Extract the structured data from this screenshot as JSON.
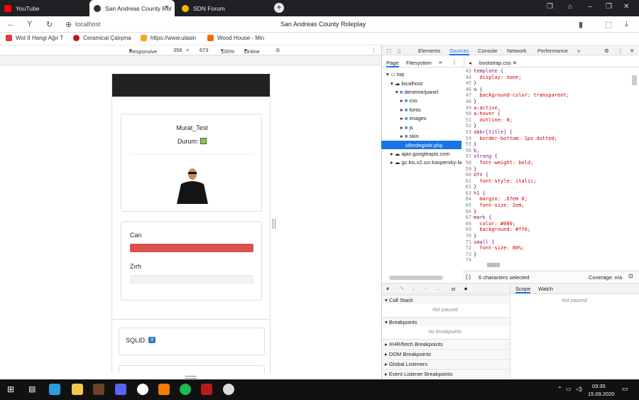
{
  "tabs": [
    {
      "label": "YouTube",
      "favcolor": "#ff0000"
    },
    {
      "label": "San Andreas County Rol",
      "favcolor": "#e8e8e8"
    },
    {
      "label": "SDN Forum",
      "favcolor": "#f5b700"
    }
  ],
  "window_title": "San Andreas County Roleplay",
  "url": "localhost",
  "bookmarks": [
    "Wot II Hangi Ağır T",
    "Ceramical Çalışma",
    "https://www.ulasin",
    "Wood House - Min"
  ],
  "device": {
    "mode": "Responsive",
    "width": "358",
    "height": "673",
    "zoom": "100%",
    "network": "Online"
  },
  "page": {
    "username": "Murat_Test",
    "durum_label": "Durum:",
    "can_label": "Can",
    "can_value": 1.0,
    "zirh_label": "Zırh",
    "zirh_value": 0,
    "sqlid_label": "SQLID:",
    "sqlid_value": "3"
  },
  "devtools": {
    "tabs": [
      "Elements",
      "Sources",
      "Console",
      "Network",
      "Performance"
    ],
    "sub_tabs": [
      "Page",
      "Filesystem"
    ],
    "file_tab": "bootstrap.css",
    "status": "6 characters selected",
    "coverage": "Coverage: n/a",
    "tree": [
      "top",
      "localhost",
      "deneme/panel",
      "css",
      "fonts",
      "images",
      "js",
      "skin",
      "sifredegistir.php",
      "ajax.googleapis.com",
      "gc.kis.v2.scr.kaspersky-la"
    ],
    "sections": [
      "Call Stack",
      "Breakpoints",
      "XHR/fetch Breakpoints",
      "DOM Breakpoints",
      "Global Listeners",
      "Event Listener Breakpoints"
    ],
    "not_paused": "Not paused",
    "no_breakpoints": "No breakpoints",
    "scope": "Scope",
    "watch": "Watch"
  },
  "code": [
    [
      "43",
      "template {"
    ],
    [
      "44",
      "  display: none;"
    ],
    [
      "45",
      "}"
    ],
    [
      "46",
      "a {"
    ],
    [
      "47",
      "  background-color: transparent;"
    ],
    [
      "48",
      "}"
    ],
    [
      "49",
      "a:active,"
    ],
    [
      "50",
      "a:hover {"
    ],
    [
      "51",
      "  outline: 0;"
    ],
    [
      "52",
      "}"
    ],
    [
      "53",
      "abbr[title] {"
    ],
    [
      "54",
      "  border-bottom: 1px dotted;"
    ],
    [
      "55",
      "}"
    ],
    [
      "56",
      "b,"
    ],
    [
      "57",
      "strong {"
    ],
    [
      "58",
      "  font-weight: bold;"
    ],
    [
      "59",
      "}"
    ],
    [
      "60",
      "dfn {"
    ],
    [
      "61",
      "  font-style: italic;"
    ],
    [
      "62",
      "}"
    ],
    [
      "63",
      "h1 {"
    ],
    [
      "64",
      "  margin: .67em 0;"
    ],
    [
      "65",
      "  font-size: 2em;"
    ],
    [
      "66",
      "}"
    ],
    [
      "67",
      "mark {"
    ],
    [
      "68",
      "  color: #000;"
    ],
    [
      "69",
      "  background: #ff0;"
    ],
    [
      "70",
      "}"
    ],
    [
      "71",
      "small {"
    ],
    [
      "72",
      "  font-size: 80%;"
    ],
    [
      "73",
      "}"
    ],
    [
      "74",
      ""
    ]
  ],
  "clock": {
    "time": "03:35",
    "date": "15.09.2020"
  }
}
